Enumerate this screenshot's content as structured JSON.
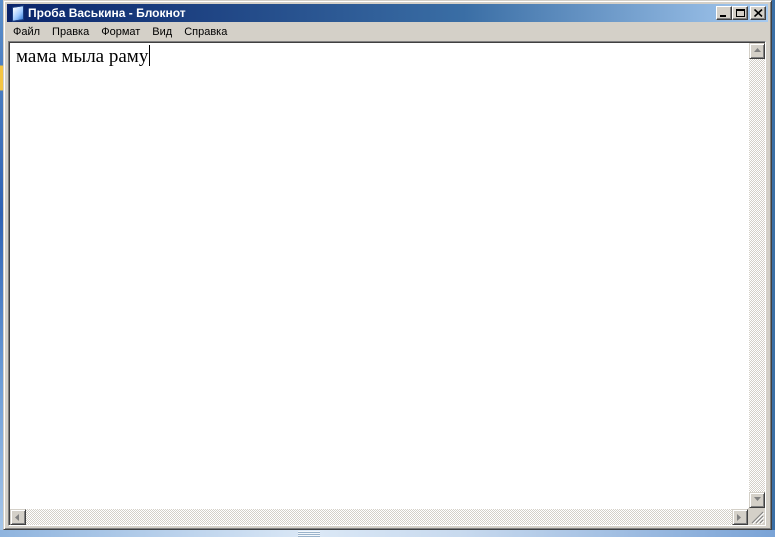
{
  "window": {
    "title": "Проба Васькина - Блокнот"
  },
  "menu": {
    "items": [
      "Файл",
      "Правка",
      "Формат",
      "Вид",
      "Справка"
    ]
  },
  "editor": {
    "text": "мама мыла раму"
  },
  "icons": {
    "app": "notepad-icon",
    "minimize": "minimize-icon",
    "maximize": "maximize-icon",
    "close": "close-icon"
  },
  "colors": {
    "title_gradient_start": "#0a246a",
    "title_gradient_end": "#a6caf0",
    "face": "#d4d0c8"
  }
}
